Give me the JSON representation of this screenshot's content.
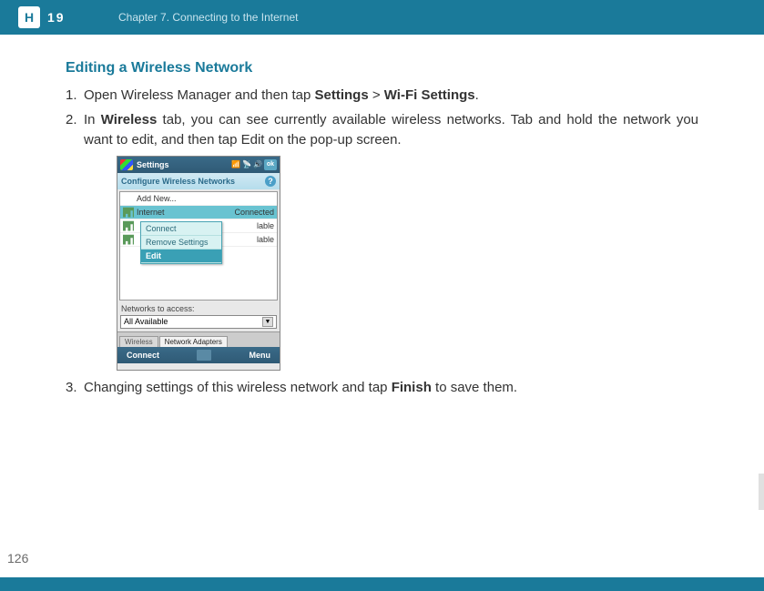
{
  "header": {
    "logo_h": "H",
    "logo_rest": "19",
    "chapter": "Chapter 7. Connecting to the Internet"
  },
  "section": {
    "title": "Editing a Wireless Network"
  },
  "steps": {
    "s1": {
      "num": "1.",
      "pre": "Open Wireless Manager and then tap ",
      "b1": "Settings",
      "sep": " > ",
      "b2": "Wi-Fi Settings",
      "post": "."
    },
    "s2": {
      "num": "2.",
      "pre": "In ",
      "b1": "Wireless",
      "post1": " tab, you can see currently available wireless networks. Tab and hold the network you want to edit, and then tap Edit on the pop-up screen."
    },
    "s3": {
      "num": "3.",
      "pre": "Changing settings of this wireless network and tap ",
      "b1": "Finish",
      "post": " to save them."
    }
  },
  "wm": {
    "title": "Settings",
    "ok": "ok",
    "subheader": "Configure Wireless Networks",
    "help": "?",
    "rows": {
      "addnew": "Add New...",
      "internet_name": "Internet",
      "internet_status": "Connected",
      "r2_status": "lable",
      "r3_status": "lable"
    },
    "popup": {
      "connect": "Connect",
      "remove": "Remove Settings",
      "edit": "Edit"
    },
    "access_label": "Networks to access:",
    "dropdown": "All Available",
    "dd_arrow": "▼",
    "tabs": {
      "wireless": "Wireless",
      "adapters": "Network Adapters"
    },
    "bottom": {
      "connect": "Connect",
      "menu": "Menu"
    },
    "tray": {
      "signal": "📶",
      "ant": "📡",
      "vol": "🔊"
    }
  },
  "page_number": "126"
}
